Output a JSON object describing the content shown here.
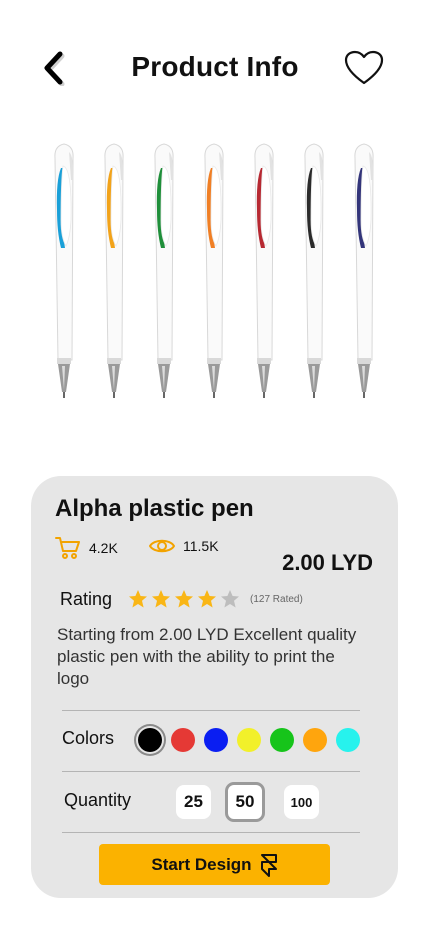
{
  "header": {
    "title": "Product Info",
    "back_icon": "chevron-left-icon",
    "favorite_icon": "heart-outline-icon"
  },
  "product": {
    "name": "Alpha plastic pen",
    "cart_count": "4.2K",
    "views_count": "11.5K",
    "price": "2.00 LYD",
    "rating_label": "Rating",
    "rating_stars": 4,
    "rating_max": 5,
    "rated_count": "(127 Rated)",
    "description": "Starting from 2.00 LYD Excellent quality plastic pen with the ability to print the logo",
    "pen_accent_colors": [
      "#1aa0d8",
      "#f2a31a",
      "#1f8f3a",
      "#f07f25",
      "#b72932",
      "#2b2b2b",
      "#33357a"
    ]
  },
  "colors": {
    "label": "Colors",
    "options": [
      "#000000",
      "#e53935",
      "#0a1ef2",
      "#f2f02a",
      "#16c41a",
      "#ffa50d",
      "#27f2ed"
    ],
    "selected_index": 0
  },
  "quantity": {
    "label": "Quantity",
    "options": [
      "25",
      "50",
      "100"
    ],
    "selected": "50"
  },
  "cta": {
    "label": "Start Design",
    "icon": "framer-icon",
    "color": "#fbb200"
  },
  "theme": {
    "star_filled": "#f9b616",
    "star_empty": "#bdbdbd",
    "card_bg": "#e6e6e6"
  }
}
